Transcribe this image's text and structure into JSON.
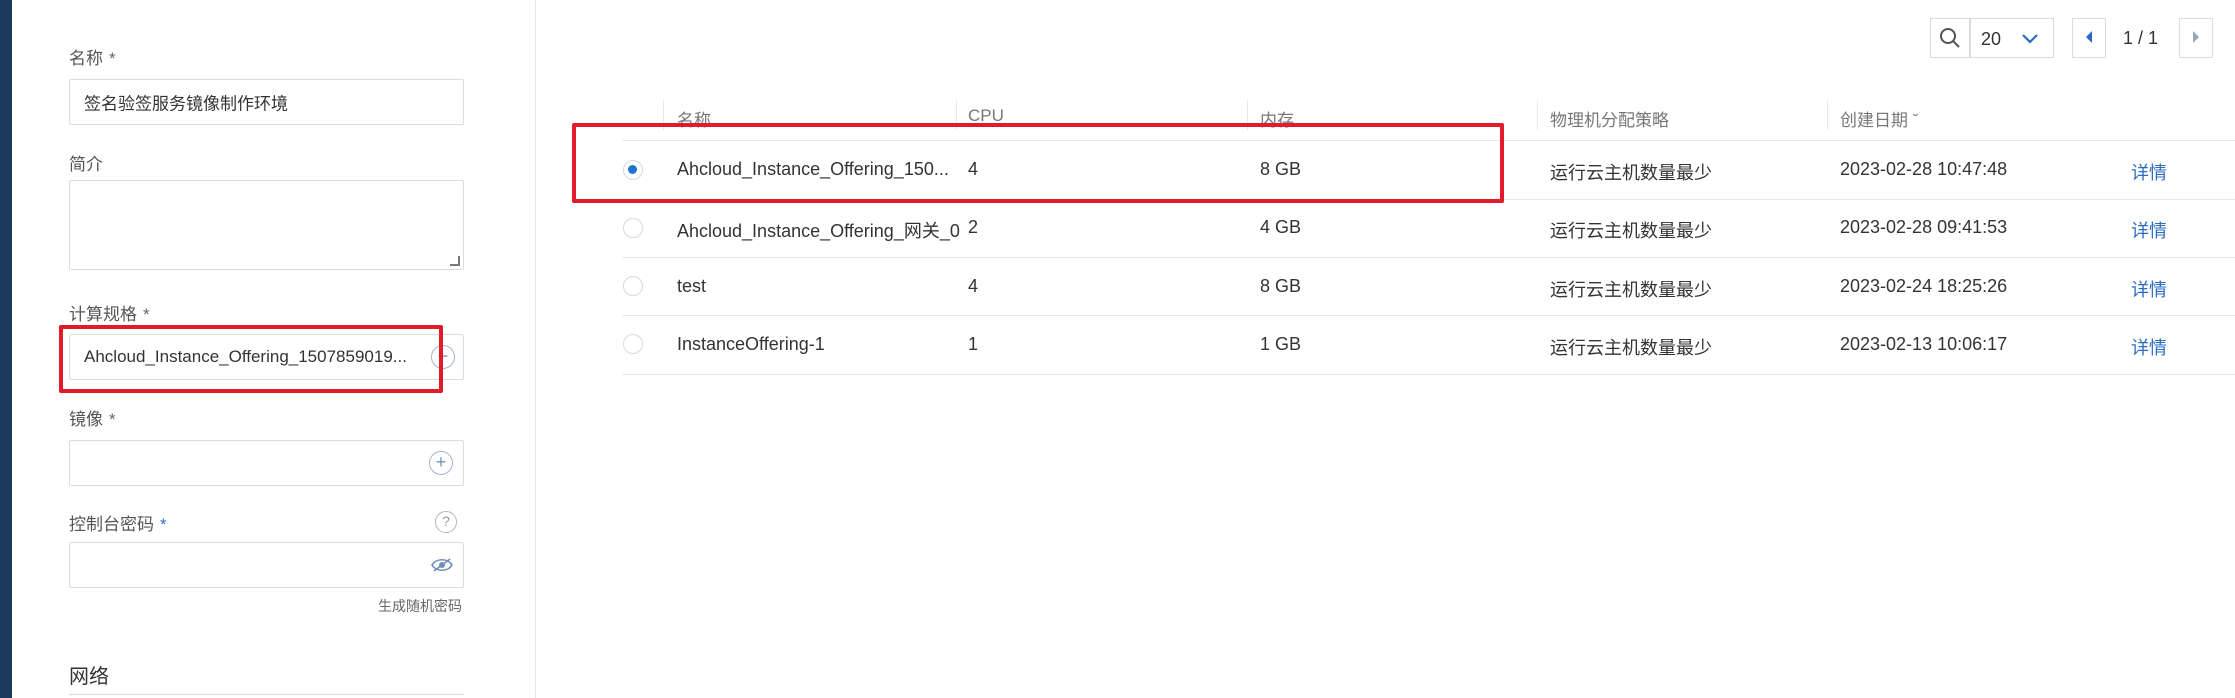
{
  "form": {
    "name_label": "名称",
    "name_value": "签名验签服务镜像制作环境",
    "description_label": "简介",
    "description_value": "",
    "compute_spec_label": "计算规格",
    "compute_spec_value": "Ahcloud_Instance_Offering_1507859019...",
    "image_label": "镜像",
    "image_value": "",
    "console_password_label": "控制台密码",
    "console_password_value": "",
    "generate_password_link": "生成随机密码",
    "network_section": "网络",
    "required_mark": "*",
    "help_glyph": "?"
  },
  "pagination": {
    "page_size": "20",
    "page_info": "1 / 1"
  },
  "table": {
    "columns": [
      "名称",
      "CPU",
      "内存",
      "物理机分配策略",
      "创建日期 ˇ"
    ],
    "detail_label": "详情",
    "rows": [
      {
        "selected": true,
        "name": "Ahcloud_Instance_Offering_150...",
        "cpu": "4",
        "memory": "8 GB",
        "strategy": "运行云主机数量最少",
        "created": "2023-02-28 10:47:48"
      },
      {
        "selected": false,
        "name": "Ahcloud_Instance_Offering_网关_0",
        "cpu": "2",
        "memory": "4 GB",
        "strategy": "运行云主机数量最少",
        "created": "2023-02-28 09:41:53"
      },
      {
        "selected": false,
        "name": "test",
        "cpu": "4",
        "memory": "8 GB",
        "strategy": "运行云主机数量最少",
        "created": "2023-02-24 18:25:26"
      },
      {
        "selected": false,
        "name": "InstanceOffering-1",
        "cpu": "1",
        "memory": "1 GB",
        "strategy": "运行云主机数量最少",
        "created": "2023-02-13 10:06:17"
      }
    ]
  },
  "colors": {
    "highlight": "#e21b2a",
    "link": "#2a6bc1",
    "radio_selected": "#1f74d3"
  }
}
